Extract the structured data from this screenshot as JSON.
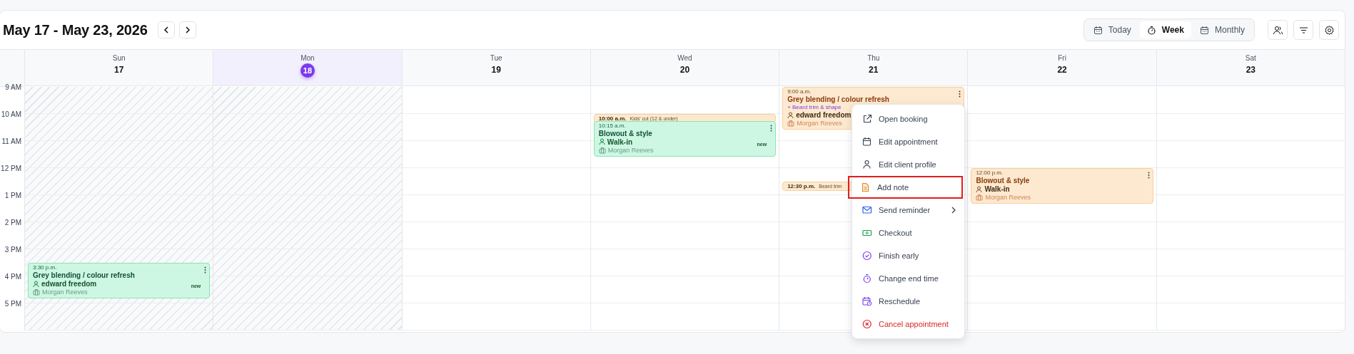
{
  "header": {
    "title": "May 17 - May 23, 2026"
  },
  "views": [
    {
      "label": "Today",
      "selected": false
    },
    {
      "label": "Week",
      "selected": true
    },
    {
      "label": "Monthly",
      "selected": false
    }
  ],
  "hours": [
    "9 AM",
    "10 AM",
    "11 AM",
    "12 PM",
    "1 PM",
    "2 PM",
    "3 PM",
    "4 PM",
    "5 PM"
  ],
  "days": [
    {
      "name": "Sun",
      "date": "17",
      "past": true,
      "selected": false,
      "events": [
        {
          "kind": "full",
          "time": "3:30 p.m.",
          "title": "Grey blending / colour refresh",
          "client": "edward freedom",
          "staff": "Morgan Reeves",
          "badge": "new",
          "color": "#cdf7e2"
        }
      ]
    },
    {
      "name": "Mon",
      "date": "18",
      "past": true,
      "selected": true
    },
    {
      "name": "Tue",
      "date": "19",
      "past": false,
      "selected": false
    },
    {
      "name": "Wed",
      "date": "20",
      "past": false,
      "selected": false,
      "events": [
        {
          "kind": "compact",
          "time": "10:00 a.m.",
          "title": "Kids' cut (12 & under)",
          "color": "#fde9cf"
        },
        {
          "kind": "full",
          "time": "10:15 a.m.",
          "title": "Blowout & style",
          "client": "Walk-in",
          "staff": "Morgan Reeves",
          "badge": "new",
          "color": "#cdf7e2"
        }
      ]
    },
    {
      "name": "Thu",
      "date": "21",
      "past": false,
      "selected": false,
      "events": [
        {
          "kind": "full",
          "time": "9:00 a.m.",
          "title": "Grey blending / colour refresh",
          "addon": "+ Beard trim & shape",
          "client": "edward freedom",
          "staff": "Morgan Reeves",
          "color": "#fde9cf"
        },
        {
          "kind": "compact",
          "time": "12:30 p.m.",
          "title": "Beard trim",
          "color": "#fde9cf"
        }
      ]
    },
    {
      "name": "Fri",
      "date": "22",
      "past": false,
      "selected": false,
      "events": [
        {
          "kind": "full",
          "time": "12:00 p.m.",
          "title": "Blowout & style",
          "client": "Walk-in",
          "staff": "Morgan Reeves",
          "color": "#fde9cf"
        }
      ]
    },
    {
      "name": "Sat",
      "date": "23",
      "past": false,
      "selected": false
    }
  ],
  "context_menu": {
    "items": [
      {
        "label": "Open booking",
        "kind": "normal",
        "selected": false,
        "submenu": false
      },
      {
        "label": "Edit appointment",
        "kind": "normal",
        "selected": false,
        "submenu": false
      },
      {
        "label": "Edit client profile",
        "kind": "normal",
        "selected": false,
        "submenu": false
      },
      {
        "label": "Add note",
        "kind": "normal",
        "selected": true,
        "submenu": false
      },
      {
        "label": "Send reminder",
        "kind": "normal",
        "selected": false,
        "submenu": true
      },
      {
        "label": "Checkout",
        "kind": "normal",
        "selected": false,
        "submenu": false
      },
      {
        "label": "Finish early",
        "kind": "normal",
        "selected": false,
        "submenu": false
      },
      {
        "label": "Change end time",
        "kind": "normal",
        "selected": false,
        "submenu": false
      },
      {
        "label": "Reschedule",
        "kind": "normal",
        "selected": false,
        "submenu": false
      },
      {
        "label": "Cancel appointment",
        "kind": "danger",
        "selected": false,
        "submenu": false
      }
    ]
  }
}
